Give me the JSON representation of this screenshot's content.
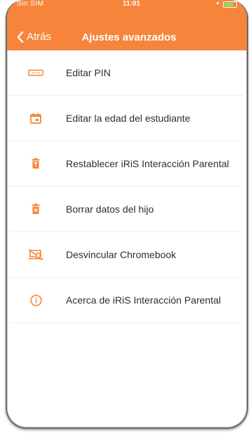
{
  "status_bar": {
    "carrier": "Sin SIM",
    "time": "11:01"
  },
  "header": {
    "back_label": "Atrás",
    "title": "Ajustes avanzados",
    "accent_color": "#f6853b"
  },
  "menu": {
    "items": [
      {
        "label": "Editar PIN",
        "icon": "pin-dots-icon"
      },
      {
        "label": "Editar la edad del estudiante",
        "icon": "calendar-icon"
      },
      {
        "label": "Restablecer iRiS Interacción Parental",
        "icon": "trash-icon"
      },
      {
        "label": "Borrar datos del hijo",
        "icon": "delete-data-icon"
      },
      {
        "label": "Desvincular Chromebook",
        "icon": "unlink-chromebook-icon"
      },
      {
        "label": "Acerca de iRiS Interacción Parental",
        "icon": "info-icon"
      }
    ]
  }
}
